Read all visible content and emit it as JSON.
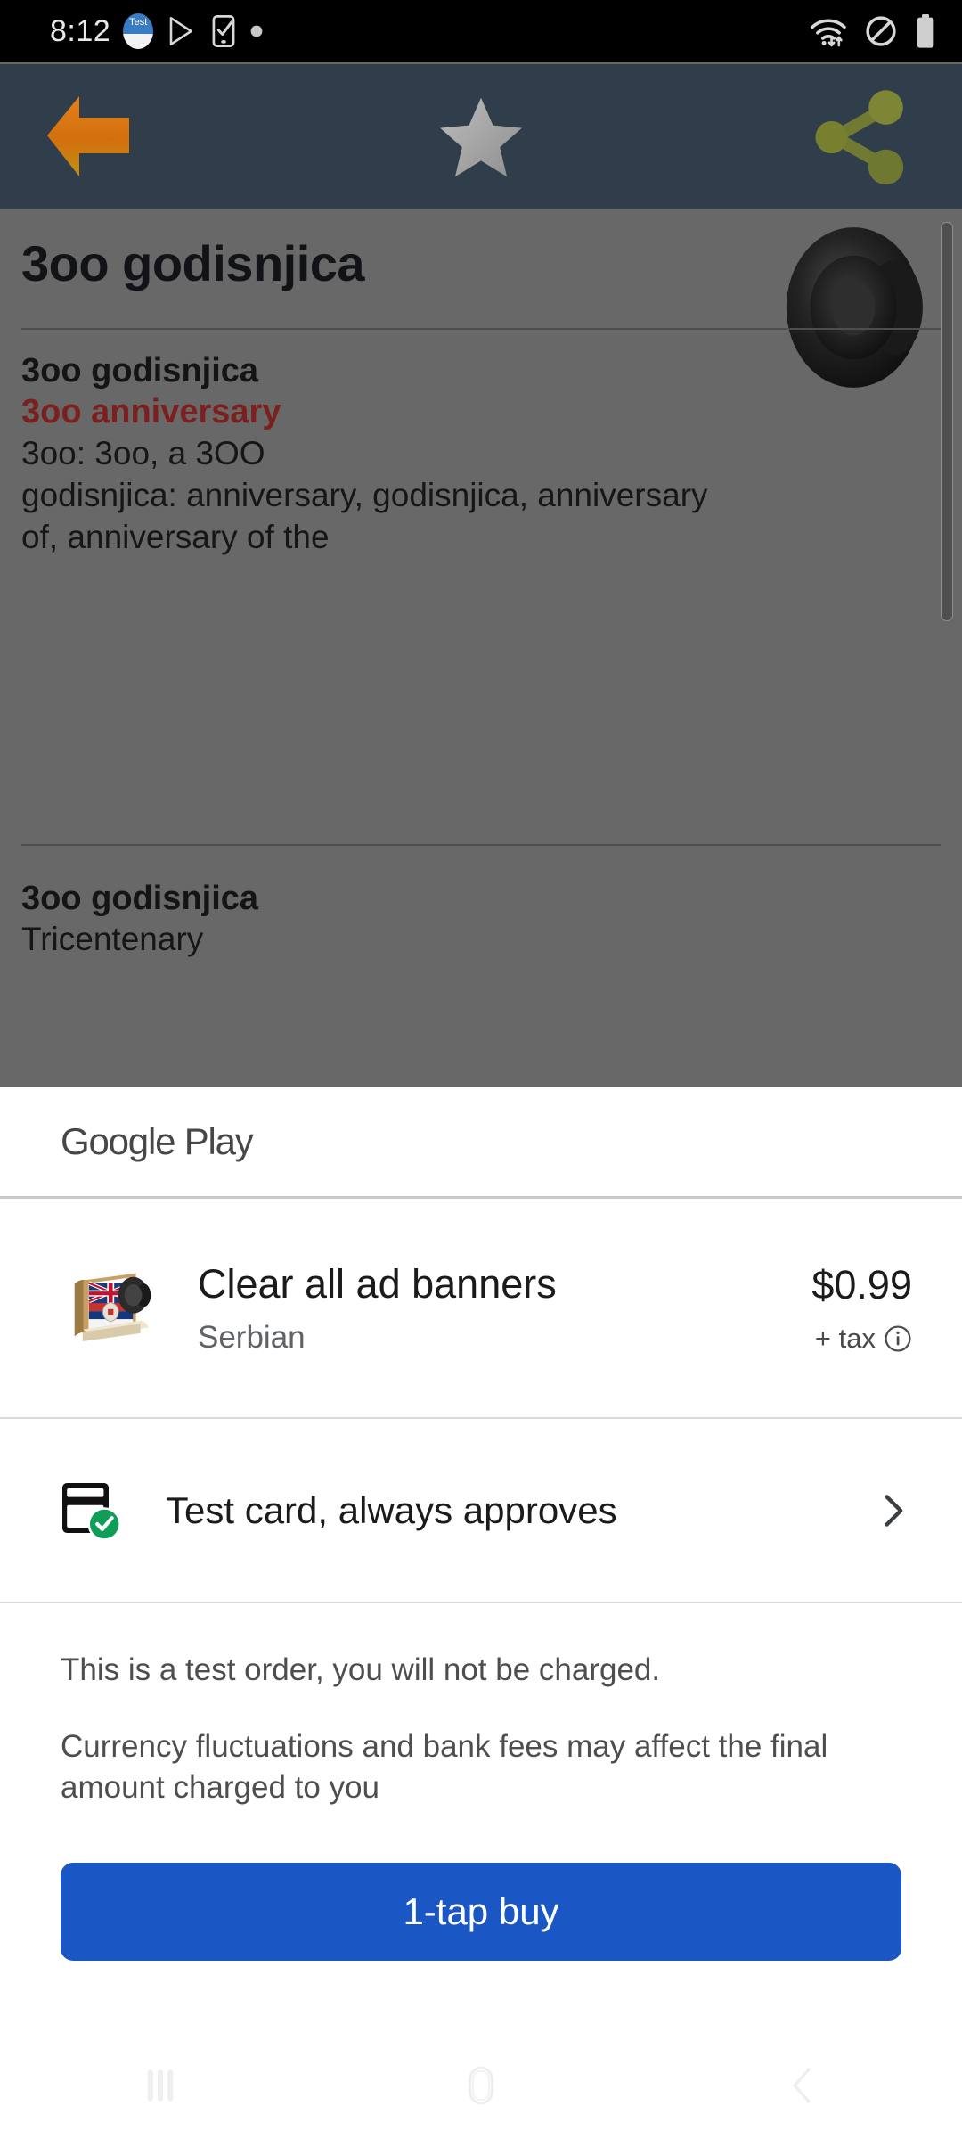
{
  "status_bar": {
    "time": "8:12",
    "icons_left": [
      "test-app-badge",
      "play-store-icon",
      "phone-check-icon",
      "dot-icon"
    ],
    "badge_text": "Test",
    "icons_right": [
      "wifi-data-icon",
      "do-not-disturb-icon",
      "battery-icon"
    ]
  },
  "app_bar": {
    "back_icon": "back-arrow-icon",
    "star_icon": "star-icon",
    "share_icon": "share-icon",
    "back_color": "#d97b16",
    "star_color": "#a9a9a9",
    "share_color": "#707a33",
    "bar_color": "#303d4a"
  },
  "dictionary": {
    "entry_title": "3oo godisnjica",
    "speaker_icon": "speaker-icon",
    "section_1": {
      "headword": "3oo godisnjica",
      "translation": "3oo anniversary",
      "lines": [
        "3oo: 3oo, a 3OO",
        "godisnjica: anniversary, godisnjica, anniversary",
        "of, anniversary of the"
      ]
    },
    "section_2": {
      "headword": "3oo godisnjica",
      "definition": "Tricentenary"
    },
    "overlay_color": "#686868",
    "translation_color": "#7c1f1f"
  },
  "sheet": {
    "brand": "Google Play",
    "product": {
      "icon": "dictionary-book-app-icon",
      "title": "Clear all ad banners",
      "subtitle": "Serbian",
      "price": "$0.99",
      "tax_label": "+ tax",
      "tax_info_icon": "info-icon"
    },
    "payment": {
      "icon": "credit-card-verified-icon",
      "label": "Test card, always approves",
      "chevron_icon": "chevron-right-icon"
    },
    "notes": [
      "This is a test order, you will not be charged.",
      "Currency fluctuations and bank fees may affect the final amount charged to you"
    ],
    "buy_button": {
      "label": "1-tap buy",
      "color": "#1a56c4"
    }
  },
  "nav_bar": {
    "recents_icon": "recents-icon",
    "home_icon": "home-icon",
    "back_icon": "nav-back-icon"
  }
}
